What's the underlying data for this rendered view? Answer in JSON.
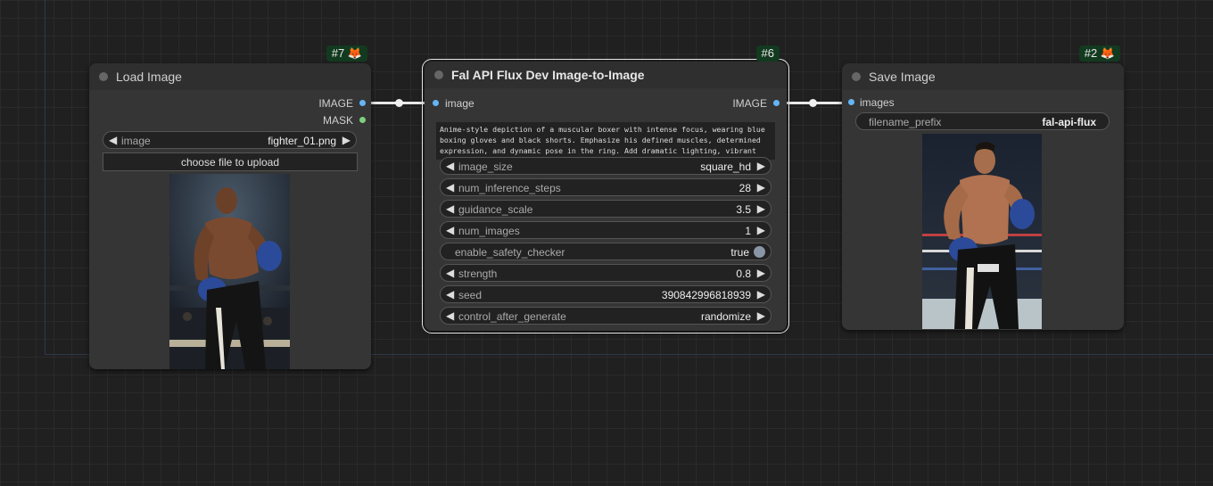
{
  "nodes": {
    "load": {
      "title": "Load Image",
      "badge": "#7 🦊",
      "outputs": [
        "IMAGE",
        "MASK"
      ],
      "image_widget": {
        "label": "image",
        "value": "fighter_01.png"
      },
      "upload_button": "choose file to upload",
      "preview_icon": "boxer-photo-preview"
    },
    "fal": {
      "title": "Fal API Flux Dev Image-to-Image",
      "badge": "#6",
      "input": "image",
      "output": "IMAGE",
      "prompt": "Anime-style depiction of a muscular boxer with intense focus, wearing blue boxing gloves and black shorts. Emphasize his defined muscles, determined expression, and dynamic pose in the ring. Add dramatic lighting, vibrant",
      "widgets": [
        {
          "label": "image_size",
          "value": "square_hd"
        },
        {
          "label": "num_inference_steps",
          "value": "28"
        },
        {
          "label": "guidance_scale",
          "value": "3.5"
        },
        {
          "label": "num_images",
          "value": "1"
        },
        {
          "label": "enable_safety_checker",
          "value": "true"
        },
        {
          "label": "strength",
          "value": "0.8"
        },
        {
          "label": "seed",
          "value": "390842996818939"
        },
        {
          "label": "control_after_generate",
          "value": "randomize"
        }
      ]
    },
    "save": {
      "title": "Save Image",
      "badge": "#2 🦊",
      "input": "images",
      "filename_widget": {
        "label": "filename_prefix",
        "value": "fal-api-flux"
      },
      "preview_icon": "anime-boxer-preview"
    }
  },
  "colors": {
    "accent_blue": "#64b5f6",
    "accent_green": "#7ccf7c",
    "badge_bg": "#123a1f"
  }
}
